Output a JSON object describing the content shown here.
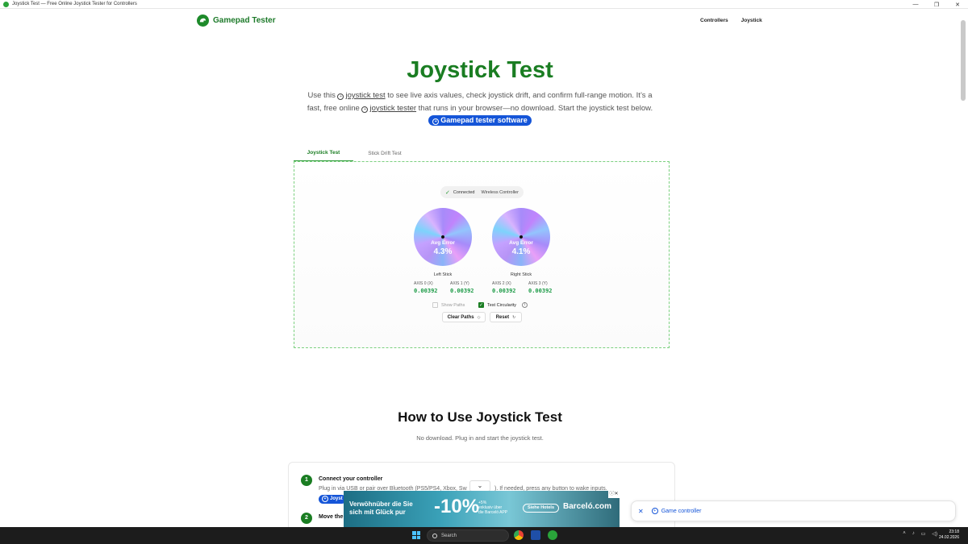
{
  "window": {
    "title": "Joystick Test — Free Online Joystick Tester for Controllers",
    "controls": [
      "—",
      "❐",
      "✕"
    ]
  },
  "nav": {
    "brand": "Gamepad Tester",
    "links": [
      "Controllers",
      "Joystick"
    ]
  },
  "hero": {
    "title": "Joystick Test",
    "desc_part1": "Use this",
    "link1": "joystick test",
    "desc_part2": "to see live axis values, check joystick drift, and confirm full-range motion. It’s a fast, free online",
    "link2": "joystick tester",
    "desc_part3": "that runs in your browser—no download. Start the joystick test below.",
    "pill": "Gamepad tester software"
  },
  "tabs": [
    "Joystick Test",
    "Stick Drift Test"
  ],
  "tester": {
    "status": "Connected",
    "device": "Wireless Controller",
    "left": {
      "name": "Left Stick",
      "error_label": "Avg Error",
      "error_value": "4.3%",
      "axes": [
        {
          "label": "AXIS 0 (X)",
          "value": "0.00392"
        },
        {
          "label": "AXIS 1 (Y)",
          "value": "0.00392"
        }
      ]
    },
    "right": {
      "name": "Right Stick",
      "error_label": "Avg Error",
      "error_value": "4.1%",
      "axes": [
        {
          "label": "AXIS 2 (X)",
          "value": "0.00392"
        },
        {
          "label": "AXIS 3 (Y)",
          "value": "0.00392"
        }
      ]
    },
    "show_paths": {
      "label": "Show Paths",
      "checked": false
    },
    "test_circularity": {
      "label": "Test Circularity",
      "checked": true
    },
    "buttons": {
      "clear": "Clear Paths",
      "reset": "Reset"
    }
  },
  "how": {
    "title": "How to Use Joystick Test",
    "subtitle": "No download. Plug in and start the joystick test.",
    "steps": [
      {
        "num": "1",
        "title": "Connect your controller",
        "text": "Plug in via USB or pair over Bluetooth (PS5/PS4, Xbox, Sw",
        "text_tail": "). If needed, press any button to wake inputs.",
        "chip": "Joyst"
      },
      {
        "num": "2",
        "title": "Move the"
      }
    ]
  },
  "ad": {
    "line1": "Verwöhnüber die Sie",
    "line2": "sich mit Glück pur",
    "percent": "-10%",
    "small1": "+5%",
    "small2": "exklusiv über",
    "small3": "die Barceló APP",
    "button": "Siehe Hotels",
    "brand": "Barceló.com",
    "close": "ⓘ✕"
  },
  "toast": {
    "close": "✕",
    "label": "Game controller"
  },
  "taskbar": {
    "search": "Search",
    "time": "23:18",
    "date": "24.02.2026"
  }
}
